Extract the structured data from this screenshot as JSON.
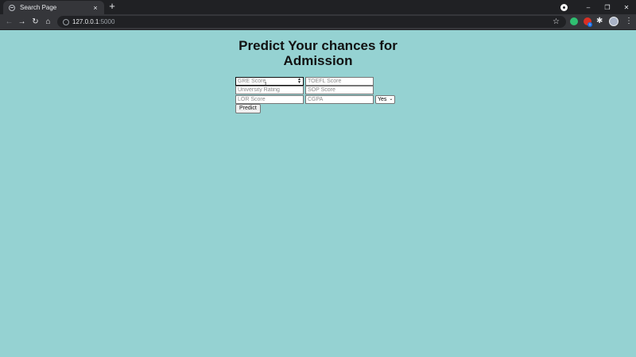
{
  "browser": {
    "tab_title": "Search Page",
    "tab_close_glyph": "×",
    "new_tab_glyph": "+",
    "url_host": "127.0.0.1",
    "url_port": ":5000",
    "window_controls": [
      "–",
      "❐",
      "✕"
    ],
    "nav_glyphs": {
      "back": "←",
      "forward": "→",
      "reload": "↻",
      "home": "⌂"
    },
    "bookmark_glyph": "☆",
    "extensions_glyph": "✱",
    "menu_glyph": "⋮",
    "extension_badge": "1"
  },
  "page": {
    "title": "Predict Your chances for Admission",
    "fields": {
      "gre": {
        "placeholder": "GRE Score",
        "icon": "spin-button-icon"
      },
      "toefl": {
        "placeholder": "TOEFL Score"
      },
      "university_rating": {
        "placeholder": "University Rating"
      },
      "sop": {
        "placeholder": "SOP Score"
      },
      "lor": {
        "placeholder": "LOR Score"
      },
      "cgpa": {
        "placeholder": "CGPA"
      }
    },
    "research_select": {
      "value": "Yes"
    },
    "predict_button": "Predict"
  },
  "colors": {
    "page_background": "#95d2d2",
    "chrome_dark": "#202124",
    "chrome_toolbar": "#35363a"
  }
}
